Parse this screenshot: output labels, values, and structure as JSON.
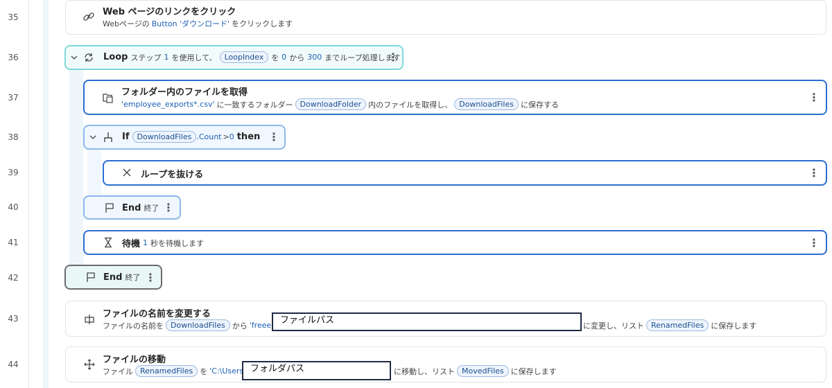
{
  "line_numbers": [
    "35",
    "36",
    "37",
    "38",
    "39",
    "40",
    "41",
    "42",
    "43",
    "44"
  ],
  "steps": {
    "s35": {
      "title": "Web ページのリンクをクリック",
      "sub_pre": "Webページの",
      "sub_lit": "Button 'ダウンロード'",
      "sub_post": "をクリックします"
    },
    "s36": {
      "keyword": "Loop",
      "t1": "ステップ",
      "step": "1",
      "t2": "を使用して、",
      "var": "LoopIndex",
      "t3": "を",
      "from": "0",
      "t4": "から",
      "to": "300",
      "t5": "までループ処理します"
    },
    "s37": {
      "title": "フォルダー内のファイルを取得",
      "lit": "'employee_exports*.csv'",
      "t1": "に一致するフォルダー",
      "var1": "DownloadFolder",
      "t2": "内のファイルを取得し、",
      "var2": "DownloadFiles",
      "t3": "に保存する"
    },
    "s38": {
      "keyword": "If",
      "var": "DownloadFiles",
      "prop": ".Count",
      "op": ">",
      "val": "0",
      "then": "then"
    },
    "s39": {
      "title": "ループを抜ける"
    },
    "s40": {
      "keyword": "End",
      "label": "終了"
    },
    "s41": {
      "keyword": "待機",
      "val": "1",
      "rest": "秒を待機します"
    },
    "s42": {
      "keyword": "End",
      "label": "終了"
    },
    "s43": {
      "title": "ファイルの名前を変更する",
      "t1": "ファイルの名前を",
      "var1": "DownloadFiles",
      "t2": "から",
      "lit": "'freee",
      "t3": "に変更し、リスト",
      "var2": "RenamedFiles",
      "t4": "に保存します",
      "overlay": "ファイルパス"
    },
    "s44": {
      "title": "ファイルの移動",
      "t1": "ファイル",
      "var1": "RenamedFiles",
      "t2": "を",
      "lit": "'C:\\Users",
      "t3": "に移動し、リスト",
      "var2": "MovedFiles",
      "t4": "に保存します",
      "overlay": "フォルダパス"
    }
  },
  "menu_glyph": "⋮"
}
